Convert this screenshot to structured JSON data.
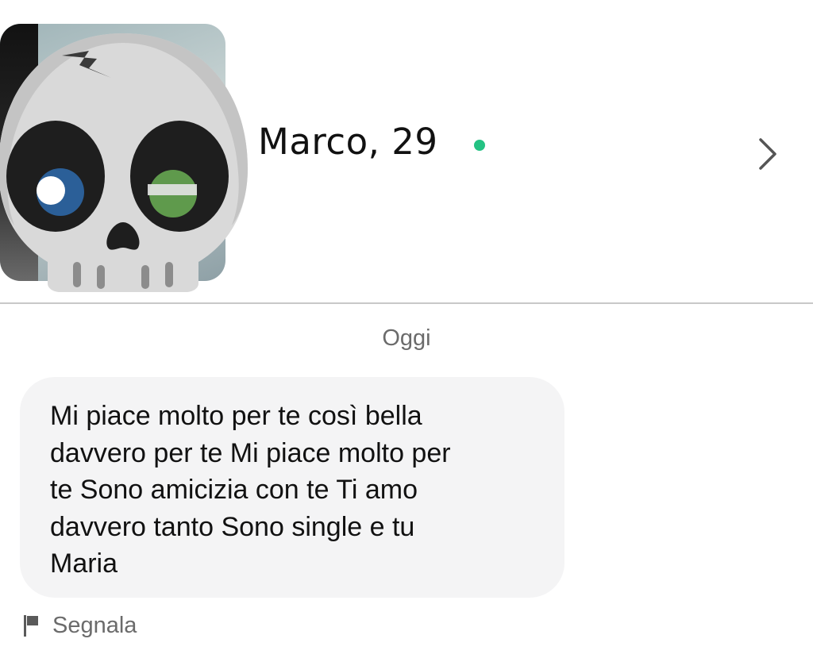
{
  "header": {
    "name_age": "Marco, 29",
    "online_color": "#24c283",
    "avatar_icon": "skull-emoji",
    "chevron_icon": "chevron-right-icon"
  },
  "chat": {
    "date_label": "Oggi",
    "messages": [
      {
        "text": "Mi piace molto per te così bella\ndavvero per te Mi piace molto per\nte Sono amicizia con te Ti amo\ndavvero tanto Sono single e tu\nMaria"
      }
    ],
    "report_label": "Segnala",
    "report_icon": "flag-icon"
  }
}
